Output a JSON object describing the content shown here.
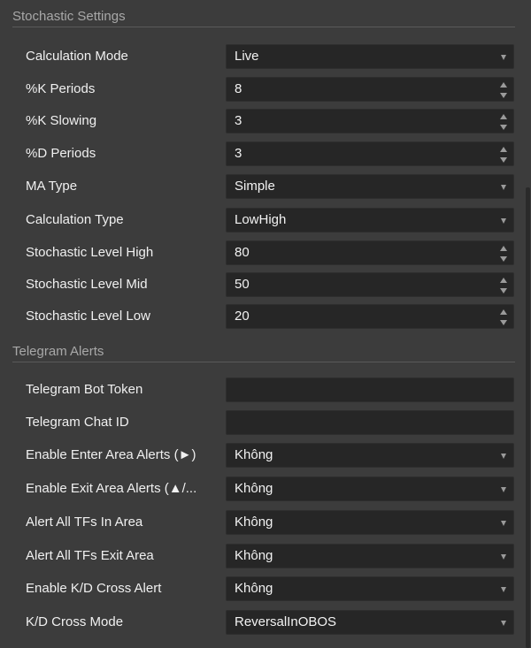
{
  "sections": {
    "stochastic": {
      "title": "Stochastic Settings",
      "rows": [
        {
          "label": "Calculation Mode",
          "value": "Live"
        },
        {
          "label": "%K Periods",
          "value": "8"
        },
        {
          "label": "%K Slowing",
          "value": "3"
        },
        {
          "label": "%D Periods",
          "value": "3"
        },
        {
          "label": "MA Type",
          "value": "Simple"
        },
        {
          "label": "Calculation Type",
          "value": "LowHigh"
        },
        {
          "label": "Stochastic Level High",
          "value": "80"
        },
        {
          "label": "Stochastic Level Mid",
          "value": "50"
        },
        {
          "label": "Stochastic Level Low",
          "value": "20"
        }
      ]
    },
    "telegram": {
      "title": "Telegram Alerts",
      "rows": [
        {
          "label": "Telegram Bot Token",
          "value": ""
        },
        {
          "label": "Telegram Chat ID",
          "value": ""
        },
        {
          "label": "Enable Enter Area Alerts (►)",
          "value": "Không"
        },
        {
          "label": "Enable Exit Area Alerts (▲/...",
          "value": "Không"
        },
        {
          "label": "Alert All TFs In Area",
          "value": "Không"
        },
        {
          "label": "Alert All TFs Exit Area",
          "value": "Không"
        },
        {
          "label": "Enable K/D Cross Alert",
          "value": "Không"
        },
        {
          "label": "K/D Cross Mode",
          "value": "ReversalInOBOS"
        }
      ]
    }
  }
}
